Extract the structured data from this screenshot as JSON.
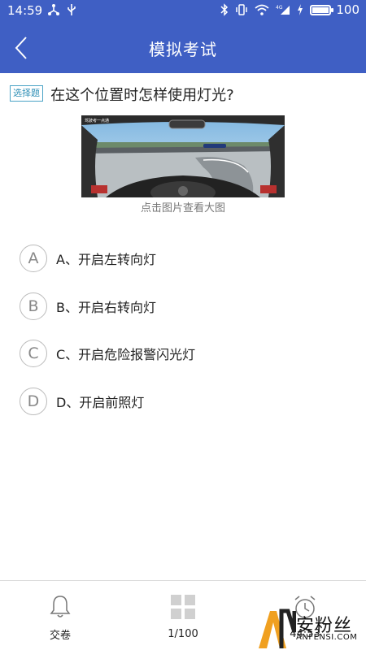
{
  "status_bar": {
    "time": "14:59",
    "battery_level": "100",
    "battery_fraction": 1.0
  },
  "header": {
    "title": "模拟考试"
  },
  "question": {
    "type_tag": "选择题",
    "text": "在这个位置时怎样使用灯光?",
    "image_caption_sign": "驾驶考一点通",
    "image_hint": "点击图片查看大图"
  },
  "options": [
    {
      "letter": "A",
      "text": "A、开启左转向灯"
    },
    {
      "letter": "B",
      "text": "B、开启右转向灯"
    },
    {
      "letter": "C",
      "text": "C、开启危险报警闪光灯"
    },
    {
      "letter": "D",
      "text": "D、开启前照灯"
    }
  ],
  "bottom_bar": {
    "submit_label": "交卷",
    "progress_label": "1/100",
    "timer_label": "44:53"
  },
  "watermark": {
    "brand": "安粉丝",
    "site": "ANFENSI.COM"
  },
  "colors": {
    "header_blue": "#3f5fc4",
    "tag_blue": "#2f8fb6"
  }
}
